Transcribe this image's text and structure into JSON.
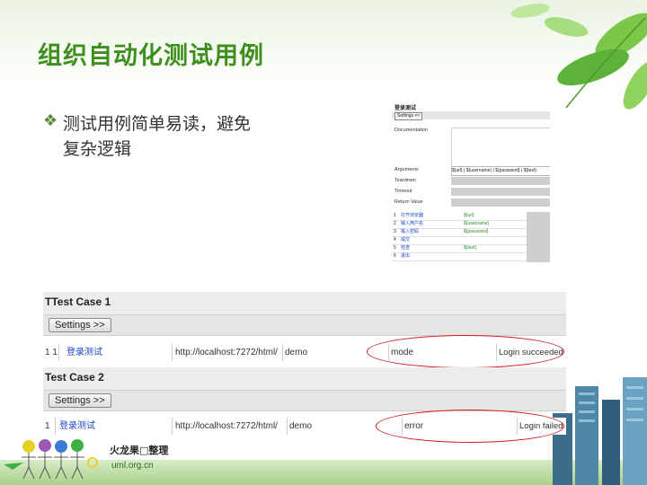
{
  "slide": {
    "title": "组织自动化测试用例",
    "bullet_symbol": "❖",
    "bullet_lines": [
      "测试用例简单易读，避免",
      "复杂逻辑"
    ]
  },
  "ride": {
    "name": "登录测试",
    "settings_label": "Settings <<",
    "labels": {
      "documentation": "Documentation",
      "arguments": "Arguments",
      "teardown": "Teardown",
      "timeout": "Timeout",
      "return_value": "Return Value"
    },
    "arguments_value": "${url} | ${username} | ${password} | ${text}",
    "steps": [
      {
        "num": "1",
        "keyword": "打开浏览器",
        "arg": "${url}"
      },
      {
        "num": "2",
        "keyword": "输入用户名",
        "arg": "${username}"
      },
      {
        "num": "3",
        "keyword": "输入密码",
        "arg": "${password}"
      },
      {
        "num": "4",
        "keyword": "提交",
        "arg": ""
      },
      {
        "num": "5",
        "keyword": "检查",
        "arg": "${text}"
      },
      {
        "num": "6",
        "keyword": "退出",
        "arg": ""
      }
    ]
  },
  "test_cases": [
    {
      "title": "Test Case 1",
      "title_prefix": "T",
      "settings_label": "Settings >>",
      "row": {
        "num": "1 1",
        "keyword": "登录测试",
        "url": "http://localhost:7272/html/",
        "user": "demo",
        "password": "mode",
        "expected": "Login succeeded"
      }
    },
    {
      "title": "Test Case 2",
      "title_prefix": "",
      "settings_label": "Settings >>",
      "row": {
        "num": "1",
        "keyword": "登录测试",
        "url": "http://localhost:7272/html/",
        "user": "demo",
        "password": "error",
        "expected": "Login failed"
      }
    }
  ],
  "watermark": {
    "text": "火龙果□整理",
    "url": "uml.org.cn"
  },
  "colors": {
    "title_green": "#3f8f1f",
    "link_blue": "#1c44c8",
    "highlight_red": "#d21818"
  }
}
